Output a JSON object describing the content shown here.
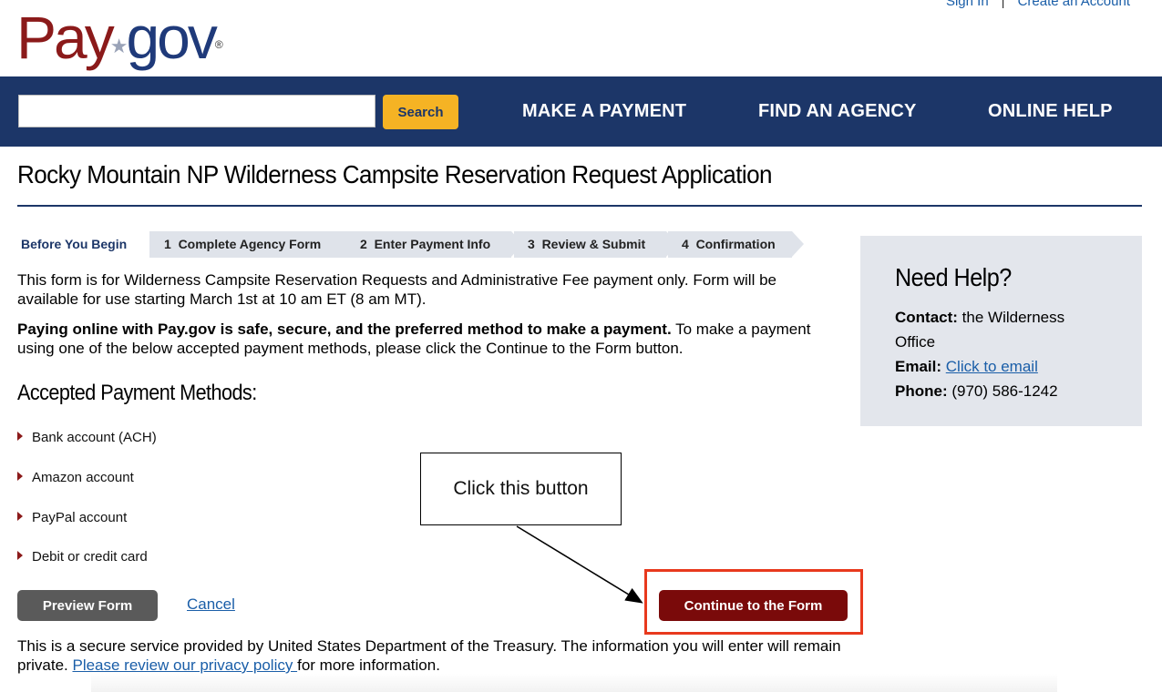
{
  "header": {
    "logo_pay": "Pay",
    "logo_gov": "gov",
    "logo_reg": "®",
    "sign_in": "Sign In",
    "separator": "|",
    "create_account": "Create an Account"
  },
  "nav": {
    "search_placeholder": "",
    "search_button": "Search",
    "items": [
      "MAKE A PAYMENT",
      "FIND AN AGENCY",
      "ONLINE HELP"
    ],
    "background_color": "#1c3668",
    "search_button_color": "#f5b324"
  },
  "page": {
    "title": "Rocky Mountain NP Wilderness Campsite Reservation Request Application"
  },
  "steps": [
    {
      "label": "Before You Begin",
      "active": true
    },
    {
      "label": "1  Complete Agency Form",
      "active": false
    },
    {
      "label": "2  Enter Payment Info",
      "active": false
    },
    {
      "label": "3  Review & Submit",
      "active": false
    },
    {
      "label": "4  Confirmation",
      "active": false
    }
  ],
  "content": {
    "para1": "This form is for Wilderness Campsite Reservation Requests and Administrative Fee payment only. Form will be available for use starting March 1st at 10 am ET (8 am MT).",
    "para2_bold": "Paying online with Pay.gov is safe, secure, and the preferred method to make a payment.",
    "para2_rest": " To make a payment using one of the below accepted payment methods, please click the Continue to the Form button.",
    "methods_heading": "Accepted Payment Methods:",
    "methods": [
      "Bank account (ACH)",
      "Amazon account",
      "PayPal account",
      "Debit or credit card"
    ],
    "bullet_icon": "triangle-right-icon"
  },
  "actions": {
    "preview": "Preview Form",
    "cancel": "Cancel",
    "continue": "Continue to the Form",
    "continue_color": "#7a0a0a",
    "highlight_color": "#e8391d"
  },
  "callout": {
    "text": "Click this button"
  },
  "footer": {
    "text_before": "This is a secure service provided by United States Department of the Treasury. The information you will enter will remain private. ",
    "privacy_link": "Please review our privacy policy ",
    "text_after": "for more information."
  },
  "help": {
    "title": "Need Help?",
    "contact_label": "Contact:",
    "contact_value_1": " the Wilderness",
    "contact_value_2": "Office",
    "email_label": "Email:",
    "email_link": "Click to email",
    "phone_label": "Phone:",
    "phone_value": " (970) 586-1242"
  }
}
